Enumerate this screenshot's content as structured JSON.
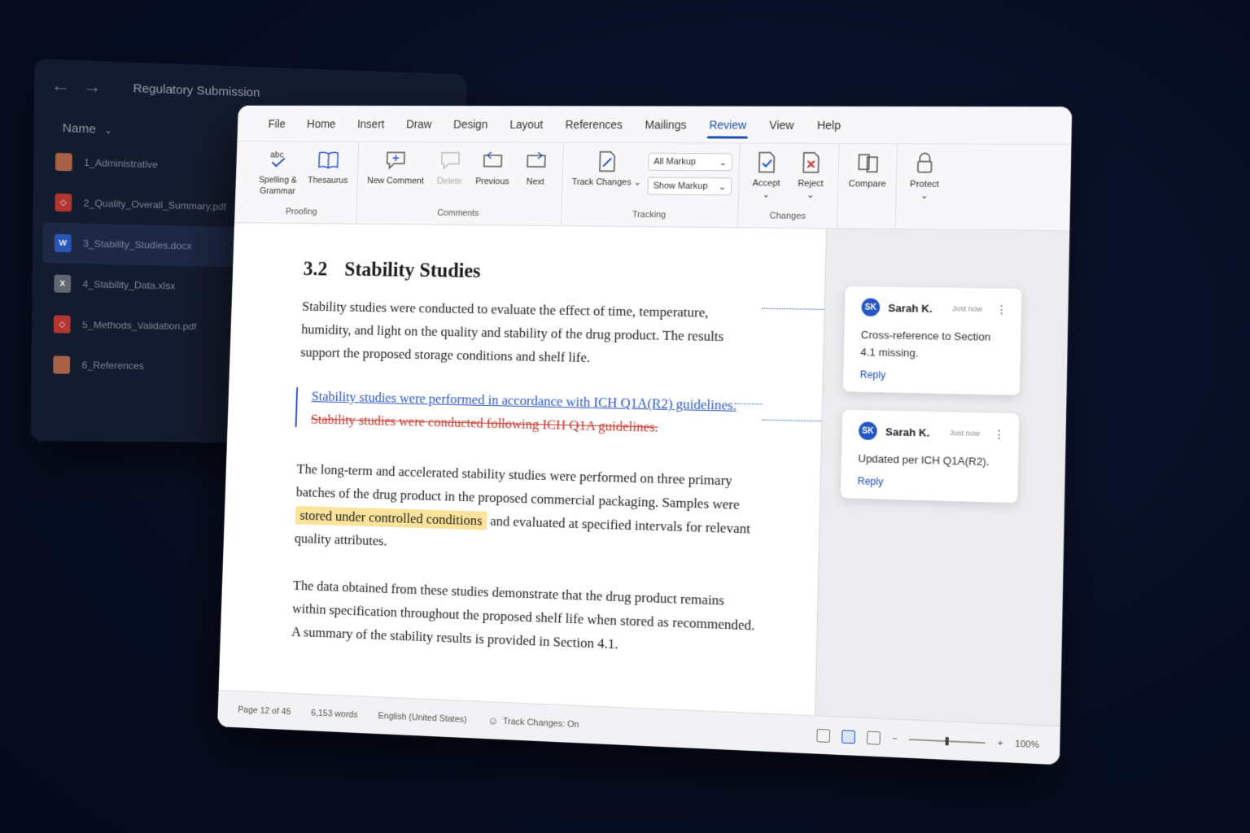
{
  "explorer": {
    "title": "Regulatory Submission",
    "column": "Name",
    "files": [
      {
        "name": "1_Administrative",
        "type": "folder"
      },
      {
        "name": "2_Quality_Overall_Summary.pdf",
        "type": "pdf"
      },
      {
        "name": "3_Stability_Studies.docx",
        "type": "word",
        "selected": true
      },
      {
        "name": "4_Stability_Data.xlsx",
        "type": "xls"
      },
      {
        "name": "5_Methods_Validation.pdf",
        "type": "pdf"
      },
      {
        "name": "6_References",
        "type": "folder"
      }
    ]
  },
  "menu": [
    "File",
    "Home",
    "Insert",
    "Draw",
    "Design",
    "Layout",
    "References",
    "Mailings",
    "Review",
    "View",
    "Help"
  ],
  "menu_active": "Review",
  "ribbon": {
    "proofing": {
      "label": "Proofing",
      "spelling": "Spelling & Grammar",
      "thesaurus": "Thesaurus"
    },
    "comments": {
      "label": "Comments",
      "new": "New Comment",
      "delete": "Delete",
      "previous": "Previous",
      "next": "Next"
    },
    "tracking": {
      "label": "Tracking",
      "track": "Track Changes",
      "markup_select": "All Markup",
      "show_markup": "Show Markup"
    },
    "changes": {
      "label": "Changes",
      "accept": "Accept",
      "reject": "Reject"
    },
    "compare": "Compare",
    "protect": "Protect"
  },
  "document": {
    "section_number": "3.2",
    "section_title": "Stability Studies",
    "para1": "Stability studies were conducted to evaluate the effect of time, temperature, humidity, and light on the quality and stability of the drug product. The results support the proposed storage conditions and shelf life.",
    "inserted": "Stability studies were performed in accordance with ICH Q1A(R2) guidelines.",
    "deleted": "Stability studies were conducted following ICH Q1A guidelines.",
    "para2_before": "The long-term and accelerated stability studies were performed on three primary batches of the drug product in the proposed commercial packaging. Samples were ",
    "para2_highlight": "stored under controlled conditions",
    "para2_after": " and evaluated at specified intervals for relevant quality attributes.",
    "para3": "The data obtained from these studies demonstrate that the drug product remains within specification throughout the proposed shelf life when stored as recommended. A summary of the stability results is provided in Section 4.1."
  },
  "comments": [
    {
      "initials": "SK",
      "author": "Sarah K.",
      "time": "Just now",
      "text": "Cross-reference to Section 4.1 missing.",
      "reply": "Reply"
    },
    {
      "initials": "SK",
      "author": "Sarah K.",
      "time": "Just now",
      "text": "Updated per ICH Q1A(R2).",
      "reply": "Reply"
    }
  ],
  "status": {
    "page": "Page 12 of 45",
    "words": "6,153 words",
    "language": "English (United States)",
    "track": "Track Changes: On",
    "zoom": "100%",
    "zoom_fraction": 0.5
  },
  "colors": {
    "accent": "#1d4fb8",
    "insert": "#2a56c6",
    "delete": "#c9362e",
    "highlight": "#fbe39b"
  }
}
